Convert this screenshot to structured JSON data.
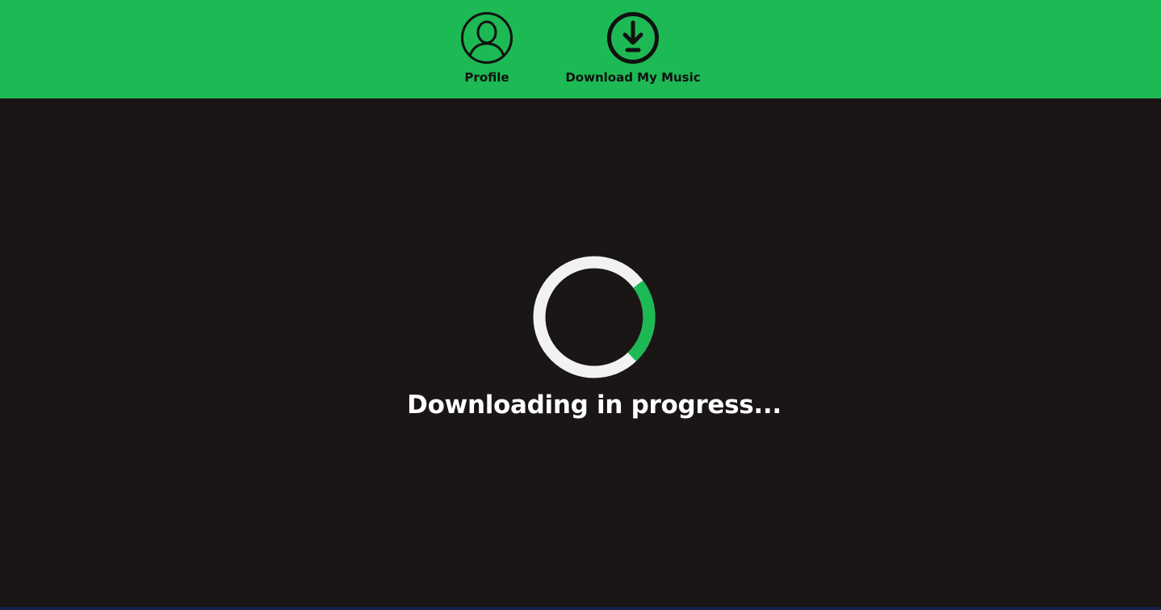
{
  "header": {
    "background_color": "#1db954",
    "nav": [
      {
        "label": "Profile",
        "icon": "user-profile-icon"
      },
      {
        "label": "Download My Music",
        "icon": "download-circle-icon"
      }
    ]
  },
  "main": {
    "background_color": "#1a1616",
    "status_text": "Downloading in progress...",
    "spinner": {
      "track_color": "#f2f2f2",
      "accent_color": "#1db954"
    }
  }
}
